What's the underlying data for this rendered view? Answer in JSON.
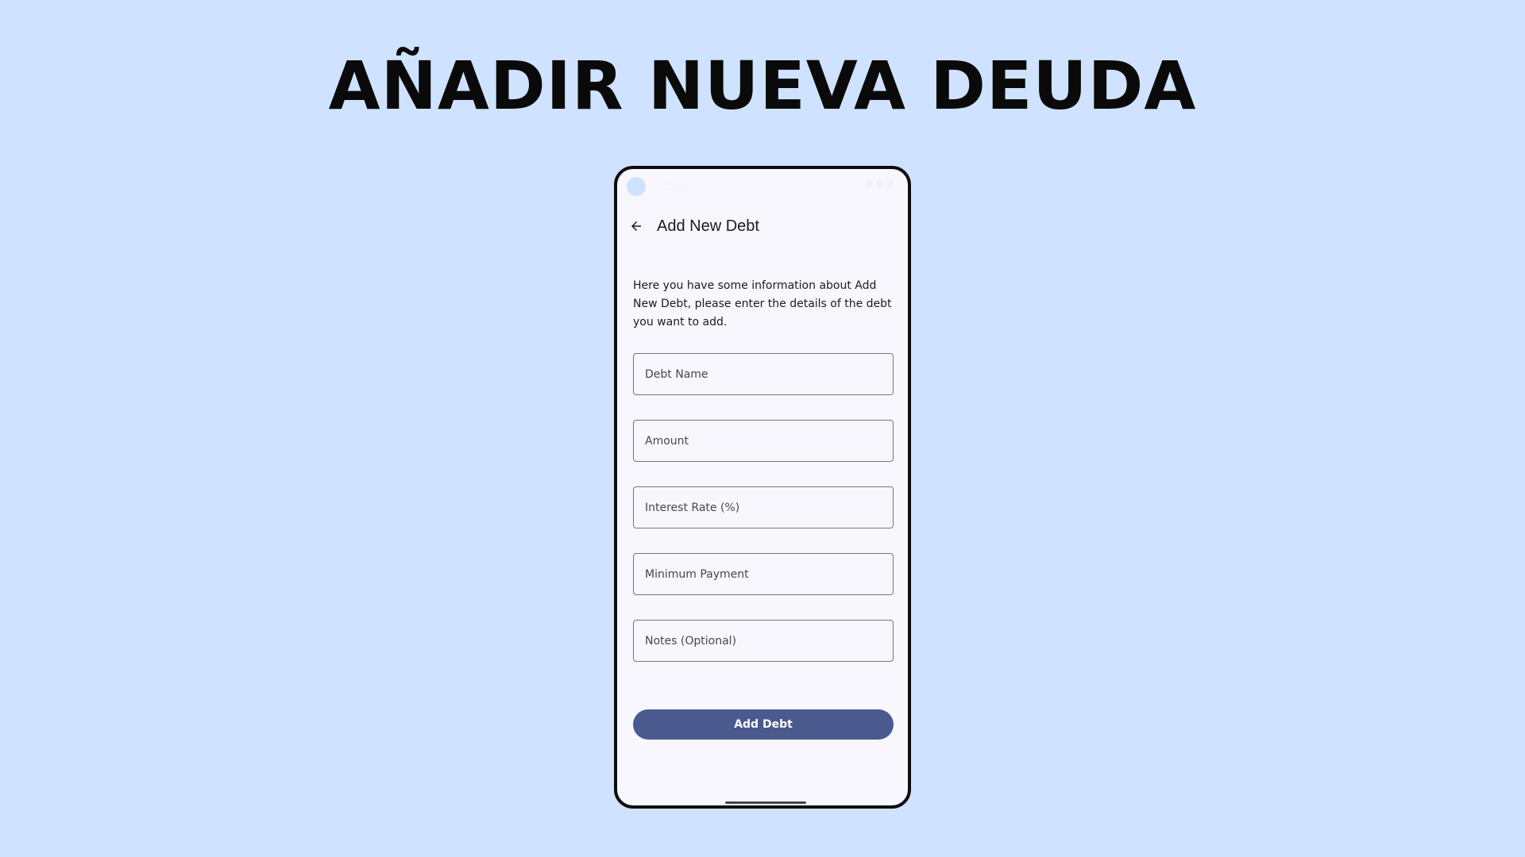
{
  "banner": {
    "title": "AÑADIR NUEVA DEUDA"
  },
  "status_bar": {
    "time": "10:00"
  },
  "app_bar": {
    "back_icon": "arrow-back-icon",
    "title": "Add New Debt"
  },
  "intro_text": "Here you have some information about Add New Debt, please enter the details of the debt you want to add.",
  "form": {
    "fields": [
      {
        "placeholder": "Debt Name",
        "value": ""
      },
      {
        "placeholder": "Amount",
        "value": ""
      },
      {
        "placeholder": "Interest Rate (%)",
        "value": ""
      },
      {
        "placeholder": "Minimum Payment",
        "value": ""
      },
      {
        "placeholder": "Notes (Optional)",
        "value": ""
      }
    ],
    "submit_label": "Add Debt"
  },
  "colors": {
    "background": "#cfe2ff",
    "phone_surface": "#f8f7fe",
    "primary_button": "#4a5a8f",
    "field_border": "#77767f"
  }
}
